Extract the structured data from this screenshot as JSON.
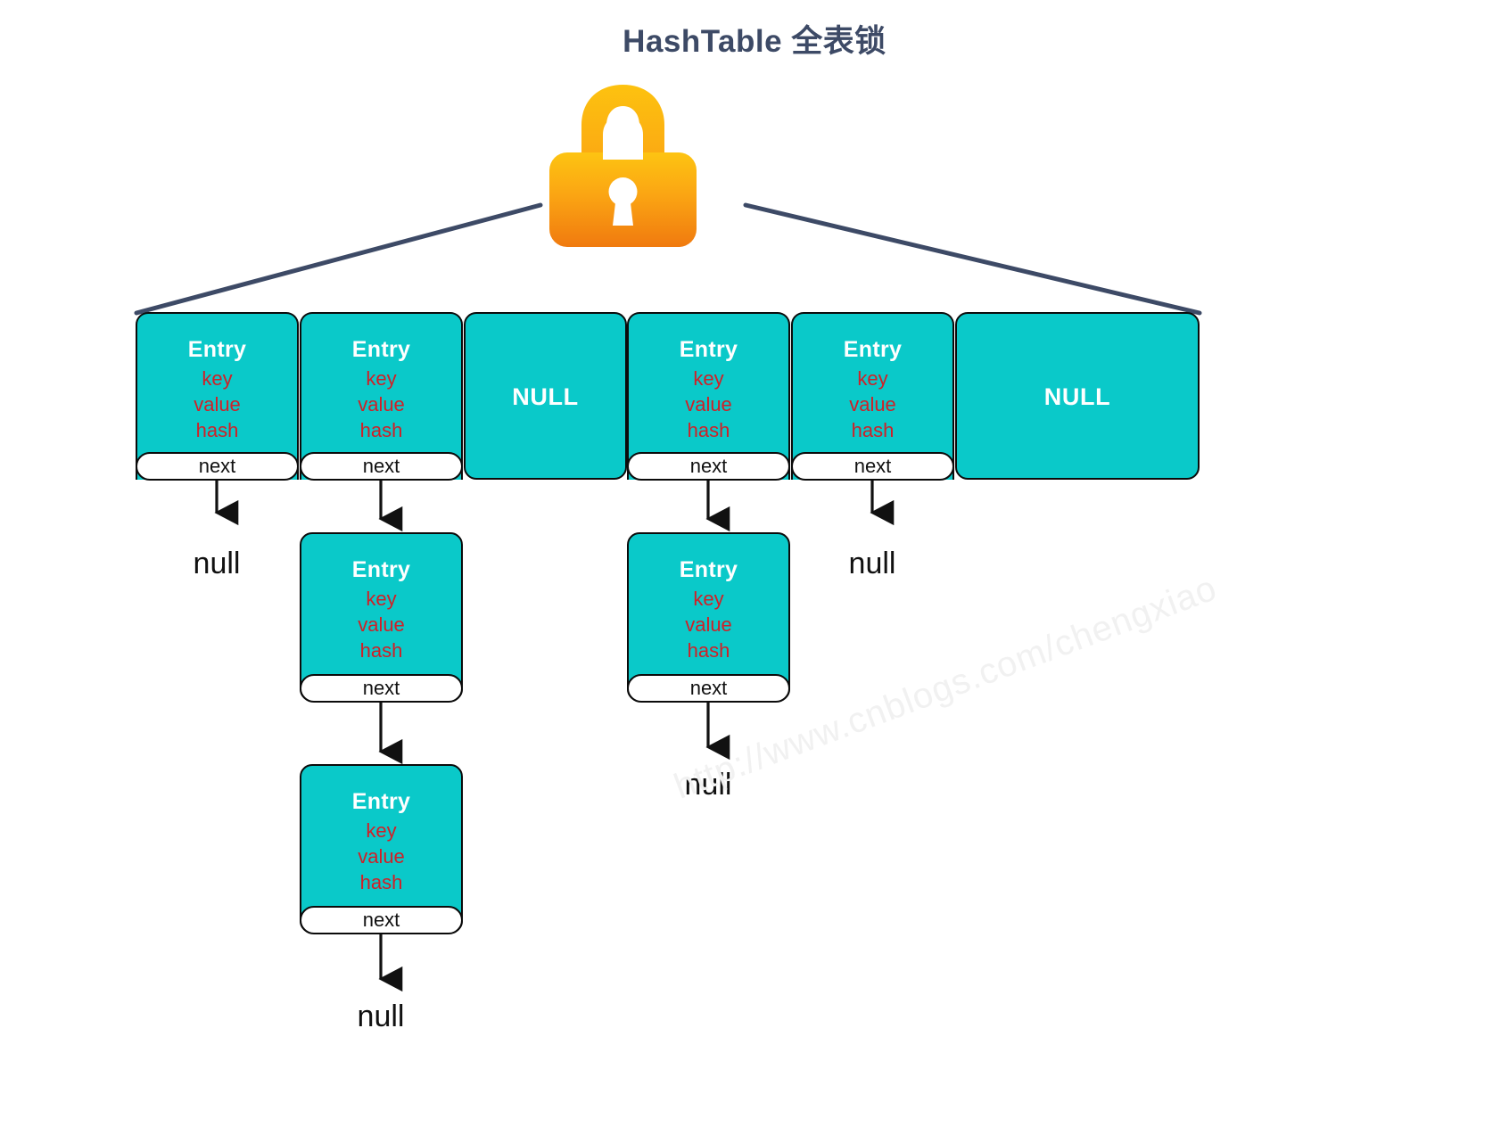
{
  "title": "HashTable 全表锁",
  "lock": {
    "icon": "padlock-icon",
    "color_top": "#fdc010",
    "color_bottom": "#f07c10"
  },
  "colors": {
    "title": "#3d4a66",
    "node_fill": "#0ac9c9",
    "node_border": "#0b0b0b",
    "field_text": "#d02027",
    "header_text": "#ffffff",
    "line": "#3d4a66",
    "arrow": "#111111",
    "watermark": "#f1f1f1"
  },
  "labels": {
    "entry": "Entry",
    "null_bucket": "NULL",
    "next": "next",
    "null_pointer": "null",
    "key": "key",
    "value": "value",
    "hash": "hash"
  },
  "buckets": [
    {
      "index": 0,
      "type": "entry",
      "header": "Entry",
      "fields": [
        "key",
        "value",
        "hash"
      ],
      "next_label": "next",
      "chain_length": 0,
      "terminator": "null"
    },
    {
      "index": 1,
      "type": "entry",
      "header": "Entry",
      "fields": [
        "key",
        "value",
        "hash"
      ],
      "next_label": "next",
      "chain_length": 2,
      "terminator": "null"
    },
    {
      "index": 2,
      "type": "null",
      "header": "NULL"
    },
    {
      "index": 3,
      "type": "entry",
      "header": "Entry",
      "fields": [
        "key",
        "value",
        "hash"
      ],
      "next_label": "next",
      "chain_length": 1,
      "terminator": "null"
    },
    {
      "index": 4,
      "type": "entry",
      "header": "Entry",
      "fields": [
        "key",
        "value",
        "hash"
      ],
      "next_label": "next",
      "chain_length": 0,
      "terminator": "null"
    },
    {
      "index": 5,
      "type": "null",
      "header": "NULL"
    }
  ],
  "chain_nodes": {
    "b1_n1": {
      "header": "Entry",
      "key": "key",
      "value": "value",
      "hash": "hash",
      "next": "next"
    },
    "b1_n2": {
      "header": "Entry",
      "key": "key",
      "value": "value",
      "hash": "hash",
      "next": "next"
    },
    "b3_n1": {
      "header": "Entry",
      "key": "key",
      "value": "value",
      "hash": "hash",
      "next": "next"
    }
  },
  "terminators": {
    "t0": "null",
    "t1": "null",
    "t3": "null",
    "t4": "null"
  },
  "watermark": "http://www.cnblogs.com/chengxiao"
}
